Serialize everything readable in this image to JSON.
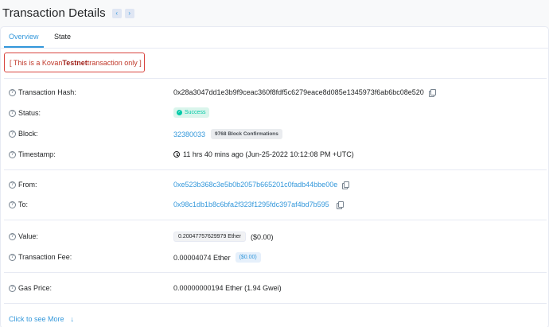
{
  "header": {
    "title": "Transaction Details",
    "prev_icon": "‹",
    "next_icon": "›"
  },
  "tabs": [
    {
      "label": "Overview"
    },
    {
      "label": "State"
    }
  ],
  "alert": {
    "prefix": "[ This is a Kovan ",
    "bold": "Testnet",
    "suffix": " transaction only ]"
  },
  "fields": {
    "tx_hash": {
      "label": "Transaction Hash:",
      "value": "0x28a3047dd1e3b9f9ceac360f8fdf5c6279eace8d085e1345973f6ab6bc08e520"
    },
    "status": {
      "label": "Status:",
      "value": "Success"
    },
    "block": {
      "label": "Block:",
      "value": "32380033",
      "confirmations": "9768 Block Confirmations"
    },
    "timestamp": {
      "label": "Timestamp:",
      "value": "11 hrs 40 mins ago (Jun-25-2022 10:12:08 PM +UTC)"
    },
    "from": {
      "label": "From:",
      "value": "0xe523b368c3e5b0b2057b665201c0fadb44bbe00e"
    },
    "to": {
      "label": "To:",
      "value": "0x98c1db1b8c6bfa2f323f1295fdc397af4bd7b595"
    },
    "value": {
      "label": "Value:",
      "amount": "0.20047757629979 Ether",
      "usd": "($0.00)"
    },
    "fee": {
      "label": "Transaction Fee:",
      "amount": "0.00004074 Ether",
      "usd": "($0.00)"
    },
    "gas_price": {
      "label": "Gas Price:",
      "value": "0.00000000194 Ether (1.94 Gwei)"
    }
  },
  "more_link": {
    "label": "Click to see More",
    "icon": "↓"
  },
  "colors": {
    "accent": "#3498db",
    "success": "#00c9a7",
    "alert": "#d9453f"
  }
}
